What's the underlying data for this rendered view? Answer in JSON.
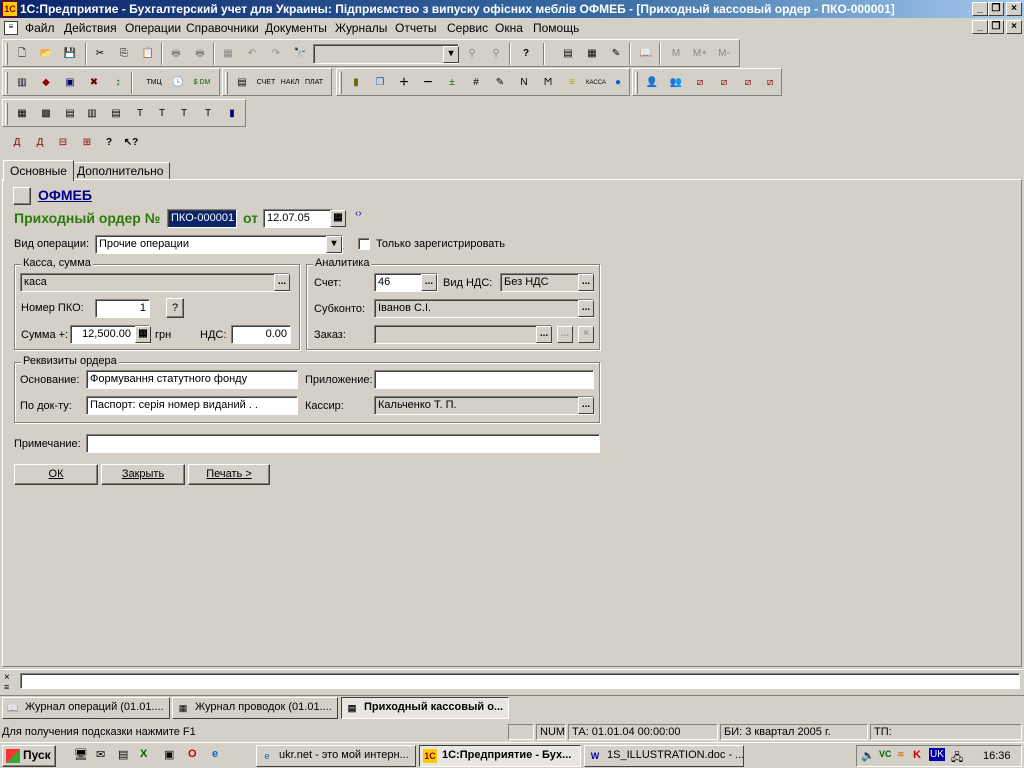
{
  "window": {
    "title": "1С:Предприятие - Бухгалтерский учет для Украины: Підприємство з випуску офісних меблів ОФМЕБ - [Приходный кассовый ордер - ПКО-000001]"
  },
  "menu": [
    "Файл",
    "Действия",
    "Операции",
    "Справочники",
    "Документы",
    "Журналы",
    "Отчеты",
    "Сервис",
    "Окна",
    "Помощь"
  ],
  "tabs": [
    "Основные",
    "Дополнительно"
  ],
  "form": {
    "org_name": "ОФМЕБ",
    "doc_title": "Приходный ордер №",
    "doc_number": "ПКО-000001",
    "date_label": "от",
    "date": "12.07.05",
    "op_type_label": "Вид операции:",
    "op_type": "Прочие операции",
    "register_only_label": "Только зарегистрировать",
    "kasa_group": "Касса, сумма",
    "kasa_value": "каса",
    "pko_label": "Номер ПКО:",
    "pko_value": "1",
    "pko_help": "?",
    "sum_label": "Сумма +:",
    "sum_value": "12,500.00",
    "currency": "грн",
    "vat_label": "НДС:",
    "vat_value": "0.00",
    "analytics_group": "Аналитика",
    "account_label": "Счет:",
    "account_value": "46",
    "vat_type_label": "Вид НДС:",
    "vat_type_value": "Без НДС",
    "subconto_label": "Субконто:",
    "subconto_value": "Іванов С.І.",
    "order_label": "Заказ:",
    "order_value": "",
    "requisites_group": "Реквизиты ордера",
    "basis_label": "Основание:",
    "basis_value": "Формування статутного фонду",
    "attachment_label": "Приложение:",
    "attachment_value": "",
    "by_doc_label": "По док-ту:",
    "by_doc_value": "Паспорт: серія  номер  виданий  . .",
    "cashier_label": "Кассир:",
    "cashier_value": "Кальченко Т. П.",
    "note_label": "Примечание:",
    "note_value": "",
    "ok_button": "ОК",
    "close_button": "Закрыть",
    "print_button": "Печать >"
  },
  "mdi_tasks": [
    "Журнал операций (01.01....",
    "Журнал проводок (01.01....",
    "Приходный кассовый о..."
  ],
  "status": {
    "hint": "Для получения подсказки нажмите F1",
    "num": "NUM",
    "ta": "ТА: 01.01.04  00:00:00",
    "bi": "БИ: 3 квартал 2005 г.",
    "tp": "ТП:"
  },
  "taskbar": {
    "start": "Пуск",
    "items": [
      "ukr.net - это мой интерн...",
      "1С:Предприятие - Бух...",
      "1S_ILLUSTRATION.doc - ..."
    ],
    "clock": "16:36"
  },
  "toolbar_text": {
    "m": "M",
    "mplus": "M+",
    "mminus": "M-",
    "tmc": "ТМЦ",
    "schet": "СЧЕТ",
    "nakl": "НАКЛ",
    "plat": "ПЛАТ",
    "kassa": "КАССА",
    "dm": "$ DM"
  }
}
